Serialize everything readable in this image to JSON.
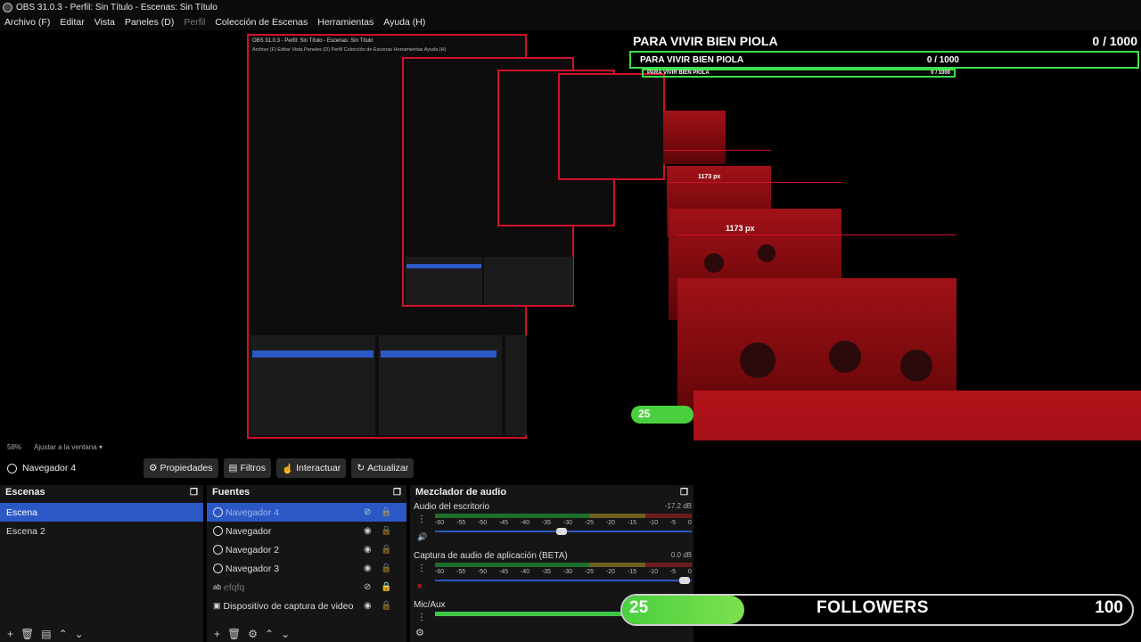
{
  "window": {
    "title": "OBS 31.0.3 - Perfil: Sin Título - Escenas: Sin Título"
  },
  "menu": [
    {
      "label": "Archivo (F)",
      "disabled": false
    },
    {
      "label": "Editar",
      "disabled": false
    },
    {
      "label": "Vista",
      "disabled": false
    },
    {
      "label": "Paneles (D)",
      "disabled": false
    },
    {
      "label": "Perfil",
      "disabled": true
    },
    {
      "label": "Colección de Escenas",
      "disabled": false
    },
    {
      "label": "Herramientas",
      "disabled": false
    },
    {
      "label": "Ayuda (H)",
      "disabled": false
    }
  ],
  "goal_overlay": {
    "title": "PARA VIVIR BIEN PIOLA",
    "count": "0",
    "goal": "/ 1000",
    "progress": 0.0
  },
  "preview": {
    "nested_title": "OBS 31.0.3 - Perfil: Sin Título - Escenas: Sin Título",
    "nested_menu": "Archivo (F)   Editar   Vista   Paneles (D)   Perfil   Colección de Escenas   Herramientas   Ayuda (H)",
    "width_label_a": "1173 px",
    "width_label_b": "1173 px",
    "nested_badge": "25"
  },
  "status": {
    "zoom": "58%",
    "fit_label": "Ajustar a la ventana"
  },
  "source_toolbar": {
    "source_name": "Navegador 4",
    "properties": "Propiedades",
    "filters": "Filtros",
    "interact": "Interactuar",
    "refresh": "Actualizar"
  },
  "scenes": {
    "header": "Escenas",
    "items": [
      {
        "label": "Escena",
        "selected": true
      },
      {
        "label": "Escena 2",
        "selected": false
      }
    ]
  },
  "sources": {
    "header": "Fuentes",
    "items": [
      {
        "label": "Navegador 4",
        "icon": "globe-icon",
        "selected": true,
        "visible": false,
        "locked": false
      },
      {
        "label": "Navegador",
        "icon": "globe-icon",
        "selected": false,
        "visible": true,
        "locked": false
      },
      {
        "label": "Navegador 2",
        "icon": "globe-icon",
        "selected": false,
        "visible": true,
        "locked": false
      },
      {
        "label": "Navegador 3",
        "icon": "globe-icon",
        "selected": false,
        "visible": true,
        "locked": false
      },
      {
        "label": "efqfq",
        "icon": "text-icon",
        "selected": false,
        "visible": false,
        "locked": true
      },
      {
        "label": "Dispositivo de captura de video",
        "icon": "camera-icon",
        "selected": false,
        "visible": true,
        "locked": false
      }
    ]
  },
  "mixer": {
    "header": "Mezclador de audio",
    "scale": [
      "-60",
      "-55",
      "-50",
      "-45",
      "-40",
      "-35",
      "-30",
      "-25",
      "-20",
      "-15",
      "-10",
      "-5",
      "0"
    ],
    "tracks": [
      {
        "name": "Audio del escritorio",
        "db": "-17.2 dB",
        "level": 0.0,
        "volume": 0.5
      },
      {
        "name": "Captura de audio de aplicación (BETA)",
        "db": "0.0 dB",
        "level": 0.0,
        "volume": 0.98
      },
      {
        "name": "Mic/Aux",
        "db": "",
        "level": 0.75,
        "volume": 0.75
      }
    ]
  },
  "followers": {
    "count": "25",
    "label": "FOLLOWERS",
    "goal": "100",
    "progress": 0.25
  },
  "colors": {
    "accent": "#2b58c4",
    "red": "#d0112b",
    "green": "#3fe04a"
  }
}
